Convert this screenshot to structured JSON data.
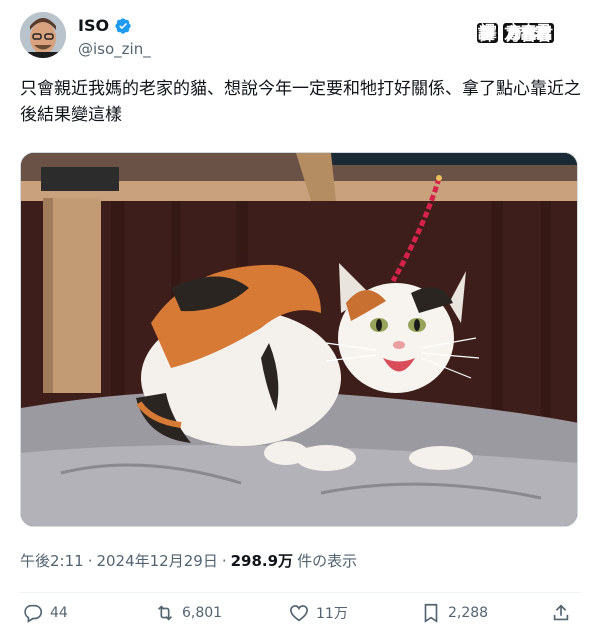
{
  "user": {
    "display_name": "ISO",
    "handle": "@iso_zin_",
    "verified": true
  },
  "watermark": {
    "prefix": "譯",
    "suffix": "方吉君"
  },
  "tweet": {
    "text": "只會親近我媽的老家的貓、想說今年一定要和牠打好關係、拿了點心靠近之後結果變這樣",
    "time": "午後2:11",
    "sep": "·",
    "date": "2024年12月29日",
    "views_count": "298.9万",
    "views_suffix": "件の表示"
  },
  "media": {
    "icon": "photo-calico-cat"
  },
  "actions": {
    "replies": "44",
    "reposts": "6,801",
    "likes": "11万",
    "bookmarks": "2,288"
  },
  "colors": {
    "verified": "#1d9bf0",
    "secondary_text": "#536471"
  }
}
